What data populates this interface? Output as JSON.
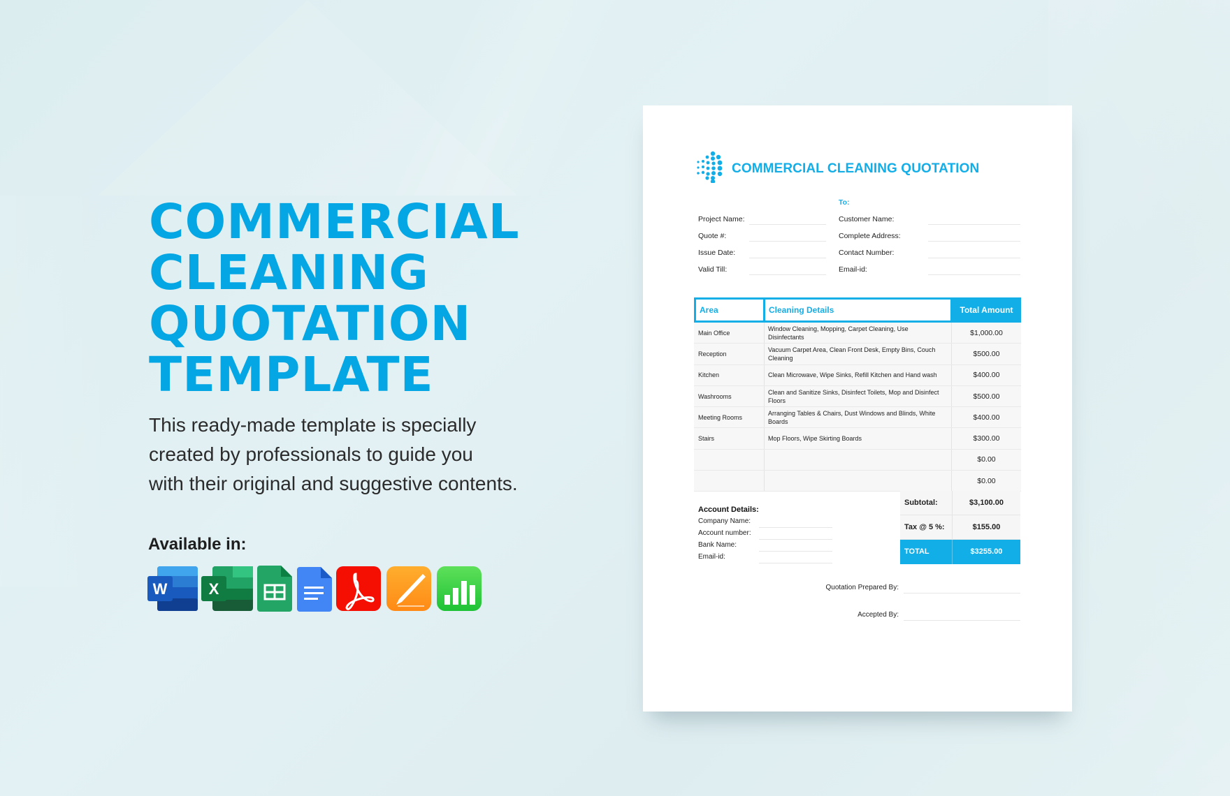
{
  "hero": {
    "title_lines": [
      "COMMERCIAL",
      "CLEANING",
      "QUOTATION",
      "TEMPLATE"
    ],
    "description_lines": [
      "This ready-made template is specially",
      "created by professionals to guide you",
      "with their original and suggestive contents."
    ],
    "available_label": "Available in:",
    "formats": [
      {
        "name": "Microsoft Word",
        "icon": "word-icon",
        "letter": "W"
      },
      {
        "name": "Microsoft Excel",
        "icon": "excel-icon",
        "letter": "X"
      },
      {
        "name": "Google Sheets",
        "icon": "google-sheets-icon"
      },
      {
        "name": "Google Docs",
        "icon": "google-docs-icon"
      },
      {
        "name": "Adobe PDF",
        "icon": "adobe-pdf-icon"
      },
      {
        "name": "Apple Pages",
        "icon": "apple-pages-icon"
      },
      {
        "name": "Apple Numbers",
        "icon": "apple-numbers-icon"
      }
    ],
    "accent_color": "#05a6e4"
  },
  "document": {
    "heading": "COMMERCIAL CLEANING QUOTATION",
    "to_label": "To:",
    "left_fields": [
      {
        "label": "Project Name:",
        "value": ""
      },
      {
        "label": "Quote #:",
        "value": ""
      },
      {
        "label": "Issue Date:",
        "value": ""
      },
      {
        "label": "Valid Till:",
        "value": ""
      }
    ],
    "right_fields": [
      {
        "label": "Customer Name:",
        "value": ""
      },
      {
        "label": "Complete Address:",
        "value": ""
      },
      {
        "label": "Contact Number:",
        "value": ""
      },
      {
        "label": "Email-id:",
        "value": ""
      }
    ],
    "table": {
      "headers": {
        "area": "Area",
        "details": "Cleaning Details",
        "amount": "Total Amount"
      },
      "rows": [
        {
          "area": "Main Office",
          "details": " Window Cleaning, Mopping, Carpet Cleaning, Use Disinfectants",
          "amount": "$1,000.00"
        },
        {
          "area": "Reception",
          "details": "Vacuum Carpet Area, Clean Front Desk, Empty Bins, Couch Cleaning",
          "amount": "$500.00"
        },
        {
          "area": "Kitchen",
          "details": "Clean Microwave, Wipe Sinks, Refill Kitchen and Hand wash",
          "amount": "$400.00"
        },
        {
          "area": "Washrooms",
          "details": "Clean and Sanitize Sinks, Disinfect Toilets, Mop and Disinfect Floors",
          "amount": "$500.00"
        },
        {
          "area": "Meeting Rooms",
          "details": "Arranging Tables & Chairs, Dust Windows and Blinds, White Boards",
          "amount": "$400.00"
        },
        {
          "area": "Stairs",
          "details": "Mop Floors, Wipe  Skirting Boards",
          "amount": "$300.00"
        },
        {
          "area": "",
          "details": "",
          "amount": "$0.00"
        },
        {
          "area": "",
          "details": "",
          "amount": "$0.00"
        }
      ]
    },
    "totals": {
      "subtotal_label": "Subtotal:",
      "subtotal": "$3,100.00",
      "tax_label": "Tax @ 5 %:",
      "tax": "$155.00",
      "total_label": "TOTAL",
      "total": "$3255.00"
    },
    "account": {
      "title": "Account Details:",
      "fields": [
        {
          "label": "Company Name:",
          "value": ""
        },
        {
          "label": "Account number:",
          "value": ""
        },
        {
          "label": "Bank Name:",
          "value": ""
        },
        {
          "label": "Email-id:",
          "value": ""
        }
      ]
    },
    "signatures": {
      "prepared_by_label": "Quotation Prepared By:",
      "accepted_by_label": "Accepted By:"
    },
    "accent_color": "#11aee8"
  }
}
